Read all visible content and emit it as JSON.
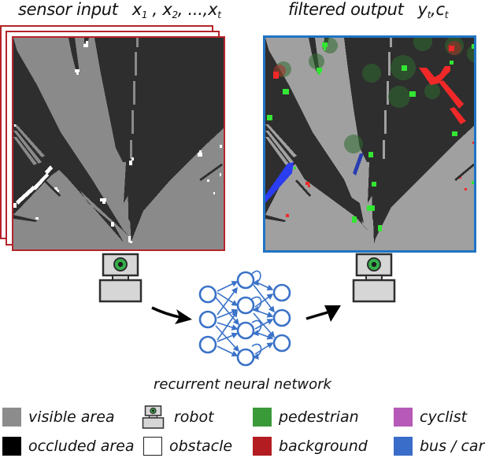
{
  "titles": {
    "left": {
      "label": "sensor input",
      "math": "x",
      "subs": [
        "1",
        "2",
        "t"
      ],
      "sep": [
        " , ",
        ", ...,"
      ]
    },
    "right": {
      "label": "filtered output",
      "math_y": "y",
      "math_c": "c",
      "sub": "t"
    }
  },
  "panels": {
    "input": {
      "name": "sensor input grid",
      "frame_color": "#b5242a",
      "stack_count": 3
    },
    "output": {
      "name": "filtered output grid",
      "frame_color": "#1f74c4"
    }
  },
  "network": {
    "label": "recurrent neural network",
    "color": "#3a72c8"
  },
  "colors": {
    "visible": "#8a8a8a",
    "visible_output": "#a0a0a0",
    "occluded": "#2e2e2e",
    "obstacle": "#ffffff",
    "pedestrian": "#3ea83e",
    "pedestrian_bright": "#33e633",
    "background": "#b31e22",
    "background_bright": "#f02828",
    "cyclist": "#b659b8",
    "bus_car": "#3a6dc9",
    "bus_car_bright": "#2a3df0"
  },
  "legend": [
    {
      "id": "visible",
      "label": "visible area",
      "swatch": "#8c8c8c"
    },
    {
      "id": "occluded",
      "label": "occluded area",
      "swatch": "#000000"
    },
    {
      "id": "robot",
      "label": "robot",
      "swatch": "robot-icon"
    },
    {
      "id": "obstacle",
      "label": "obstacle",
      "swatch": "#ffffff"
    },
    {
      "id": "pedestrian",
      "label": "pedestrian",
      "swatch": "#3a9a3a"
    },
    {
      "id": "background",
      "label": "background",
      "swatch": "#b31c20"
    },
    {
      "id": "cyclist",
      "label": "cyclist",
      "swatch": "#b659b8"
    },
    {
      "id": "bus_car",
      "label": "bus / car",
      "swatch": "#3a6dc9"
    }
  ]
}
